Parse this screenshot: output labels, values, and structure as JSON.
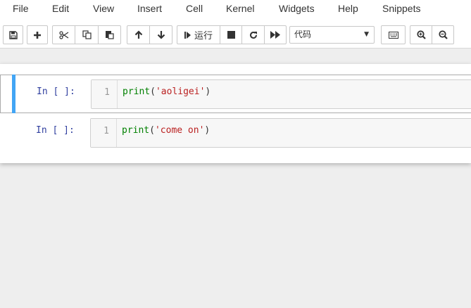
{
  "menubar": {
    "items": [
      "File",
      "Edit",
      "View",
      "Insert",
      "Cell",
      "Kernel",
      "Widgets",
      "Help",
      "Snippets"
    ]
  },
  "toolbar": {
    "buttons": [
      {
        "name": "save",
        "icon": "floppy-disk-icon"
      },
      {
        "name": "insert-cell",
        "icon": "plus-icon"
      },
      {
        "name": "cut",
        "icon": "scissors-icon"
      },
      {
        "name": "copy",
        "icon": "copy-icon"
      },
      {
        "name": "paste",
        "icon": "paste-icon"
      },
      {
        "name": "move-up",
        "icon": "arrow-up-icon"
      },
      {
        "name": "move-down",
        "icon": "arrow-down-icon"
      },
      {
        "name": "run",
        "icon": "step-forward-icon"
      },
      {
        "name": "interrupt",
        "icon": "stop-icon"
      },
      {
        "name": "restart",
        "icon": "redo-icon"
      },
      {
        "name": "restart-run-all",
        "icon": "fast-forward-icon"
      },
      {
        "name": "command-palette",
        "icon": "keyboard-icon"
      },
      {
        "name": "zoom-in",
        "icon": "zoom-in-icon"
      },
      {
        "name": "zoom-out",
        "icon": "zoom-out-icon"
      }
    ],
    "run_label": "运行",
    "cell_type": {
      "selected": "代码",
      "caret": "▼"
    }
  },
  "cells": [
    {
      "prompt": "In [ ]:",
      "line_number": "1",
      "code": {
        "func": "print",
        "open": "(",
        "string": "'aoligei'",
        "close": ")"
      },
      "selected": true
    },
    {
      "prompt": "In [ ]:",
      "line_number": "1",
      "code": {
        "func": "print",
        "open": "(",
        "string": "'come on'",
        "close": ")"
      },
      "selected": false
    }
  ],
  "colors": {
    "selected_cell_bar": "#42a5f5",
    "prompt": "#303f9f",
    "builtin": "#008000",
    "string": "#ba2121"
  }
}
